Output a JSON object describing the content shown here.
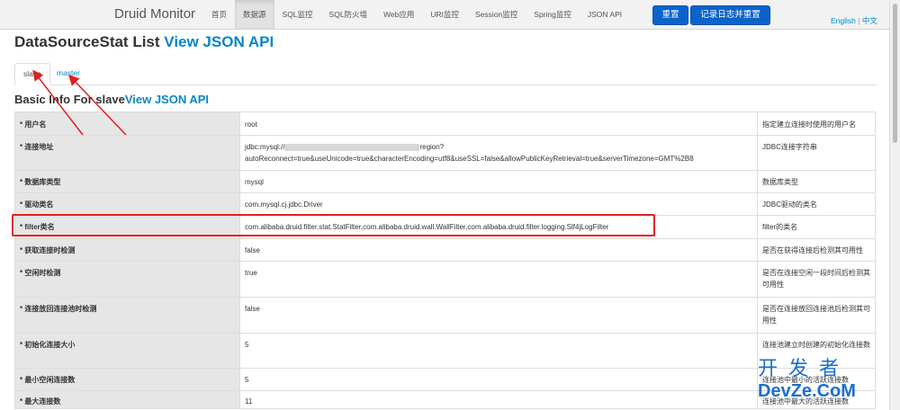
{
  "navbar": {
    "brand": "Druid Monitor",
    "items": [
      "首页",
      "数据源",
      "SQL监控",
      "SQL防火墙",
      "Web应用",
      "URI监控",
      "Session监控",
      "Spring监控",
      "JSON API"
    ],
    "reset_label": "重置",
    "reset_log_label": "记录日志并重置",
    "lang_en": "English",
    "lang_sep": "|",
    "lang_zh": "中文"
  },
  "page": {
    "title": "DataSourceStat List",
    "title_link": "View JSON API",
    "tabs": [
      "slave",
      "master"
    ],
    "subtitle": "Basic Info For slave",
    "subtitle_link": "View JSON API"
  },
  "rows": [
    {
      "key": "* 用户名",
      "value": "root",
      "desc": "指定建立连接时使用的用户名"
    },
    {
      "key": "* 连接地址",
      "value_a": "jdbc:mysql://",
      "value_b": "region?",
      "value_c": "autoReconnect=true&useUnicode=true&characterEncoding=utf8&useSSL=false&allowPublicKeyRetrieval=true&serverTimezone=GMT%2B8",
      "desc": "JDBC连接字符串"
    },
    {
      "key": "* 数据库类型",
      "value": "mysql",
      "desc": "数据库类型"
    },
    {
      "key": "* 驱动类名",
      "value": "com.mysql.cj.jdbc.Driver",
      "desc": "JDBC驱动的类名"
    },
    {
      "key": "* filter类名",
      "value": "com.alibaba.druid.filter.stat.StatFilter,com.alibaba.druid.wall.WallFilter,com.alibaba.druid.filter.logging.Slf4jLogFilter",
      "desc": "filter的类名"
    },
    {
      "key": "* 获取连接时检测",
      "value": "false",
      "desc": "是否在获得连接后检测其可用性"
    },
    {
      "key": "* 空闲时检测",
      "value": "true",
      "desc": "是否在连接空闲一段时间后检测其可用性"
    },
    {
      "key": "* 连接放回连接池时检测",
      "value": "false",
      "desc": "是否在连接放回连接池后检测其可用性"
    },
    {
      "key": "* 初始化连接大小",
      "value": "5",
      "desc": "连接池建立时创建的初始化连接数"
    },
    {
      "key": "* 最小空闲连接数",
      "value": "5",
      "desc": "连接池中最小的活跃连接数"
    },
    {
      "key": "* 最大连接数",
      "value": "11",
      "desc": "连接池中最大的活跃连接数"
    }
  ],
  "watermark": {
    "top": "开发者",
    "bottom": "DevZe.CoM"
  },
  "colors": {
    "highlight": "#e02020",
    "link": "#0a85c6",
    "button": "#0a63c8"
  }
}
